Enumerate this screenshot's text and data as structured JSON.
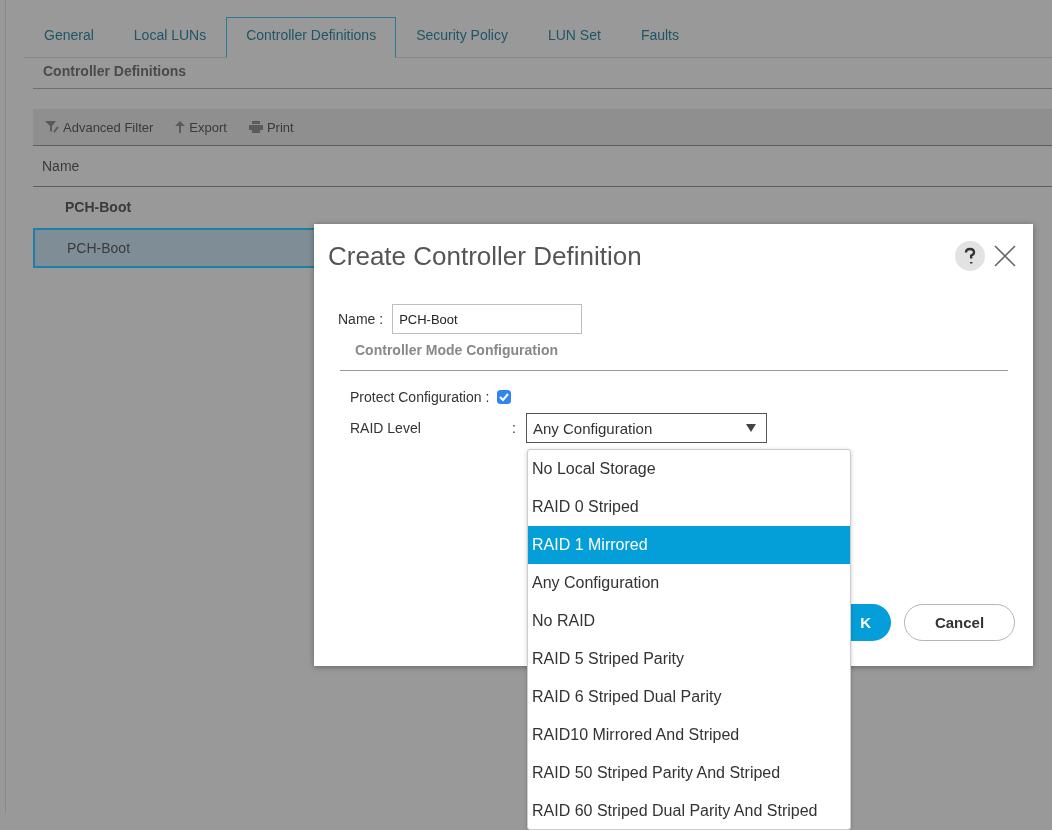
{
  "tabs": [
    {
      "label": "General",
      "selected": false
    },
    {
      "label": "Local LUNs",
      "selected": false
    },
    {
      "label": "Controller Definitions",
      "selected": true
    },
    {
      "label": "Security Policy",
      "selected": false
    },
    {
      "label": "LUN Set",
      "selected": false
    },
    {
      "label": "Faults",
      "selected": false
    }
  ],
  "section_title": "Controller Definitions",
  "toolbar": [
    {
      "kind": "filter",
      "label": "Advanced Filter"
    },
    {
      "kind": "export",
      "label": "Export"
    },
    {
      "kind": "print",
      "label": "Print"
    }
  ],
  "table": {
    "columns": [
      "Name"
    ],
    "rows": [
      {
        "kind": "group",
        "name": "PCH-Boot",
        "selected": false
      },
      {
        "kind": "item",
        "name": "PCH-Boot",
        "selected": true
      }
    ]
  },
  "dialog": {
    "title": "Create Controller Definition",
    "name_label": "Name :",
    "name_value": "PCH-Boot",
    "section": "Controller Mode Configuration",
    "protect_label": "Protect Configuration :",
    "protect_checked": true,
    "raid_label": "RAID Level",
    "raid_colon": ":",
    "raid_value": "Any Configuration",
    "raid_options": [
      {
        "label": "No Local Storage",
        "selected": false
      },
      {
        "label": "RAID 0 Striped",
        "selected": false
      },
      {
        "label": "RAID 1 Mirrored",
        "selected": true
      },
      {
        "label": "Any Configuration",
        "selected": false
      },
      {
        "label": "No RAID",
        "selected": false
      },
      {
        "label": "RAID 5 Striped Parity",
        "selected": false
      },
      {
        "label": "RAID 6 Striped Dual Parity",
        "selected": false
      },
      {
        "label": "RAID10 Mirrored And Striped",
        "selected": false
      },
      {
        "label": "RAID 50 Striped Parity And Striped",
        "selected": false
      },
      {
        "label": "RAID 60 Striped Dual Parity And Striped",
        "selected": false
      }
    ],
    "buttons": [
      {
        "kind": "primary",
        "label": "K"
      },
      {
        "kind": "secondary",
        "label": "Cancel"
      }
    ]
  }
}
